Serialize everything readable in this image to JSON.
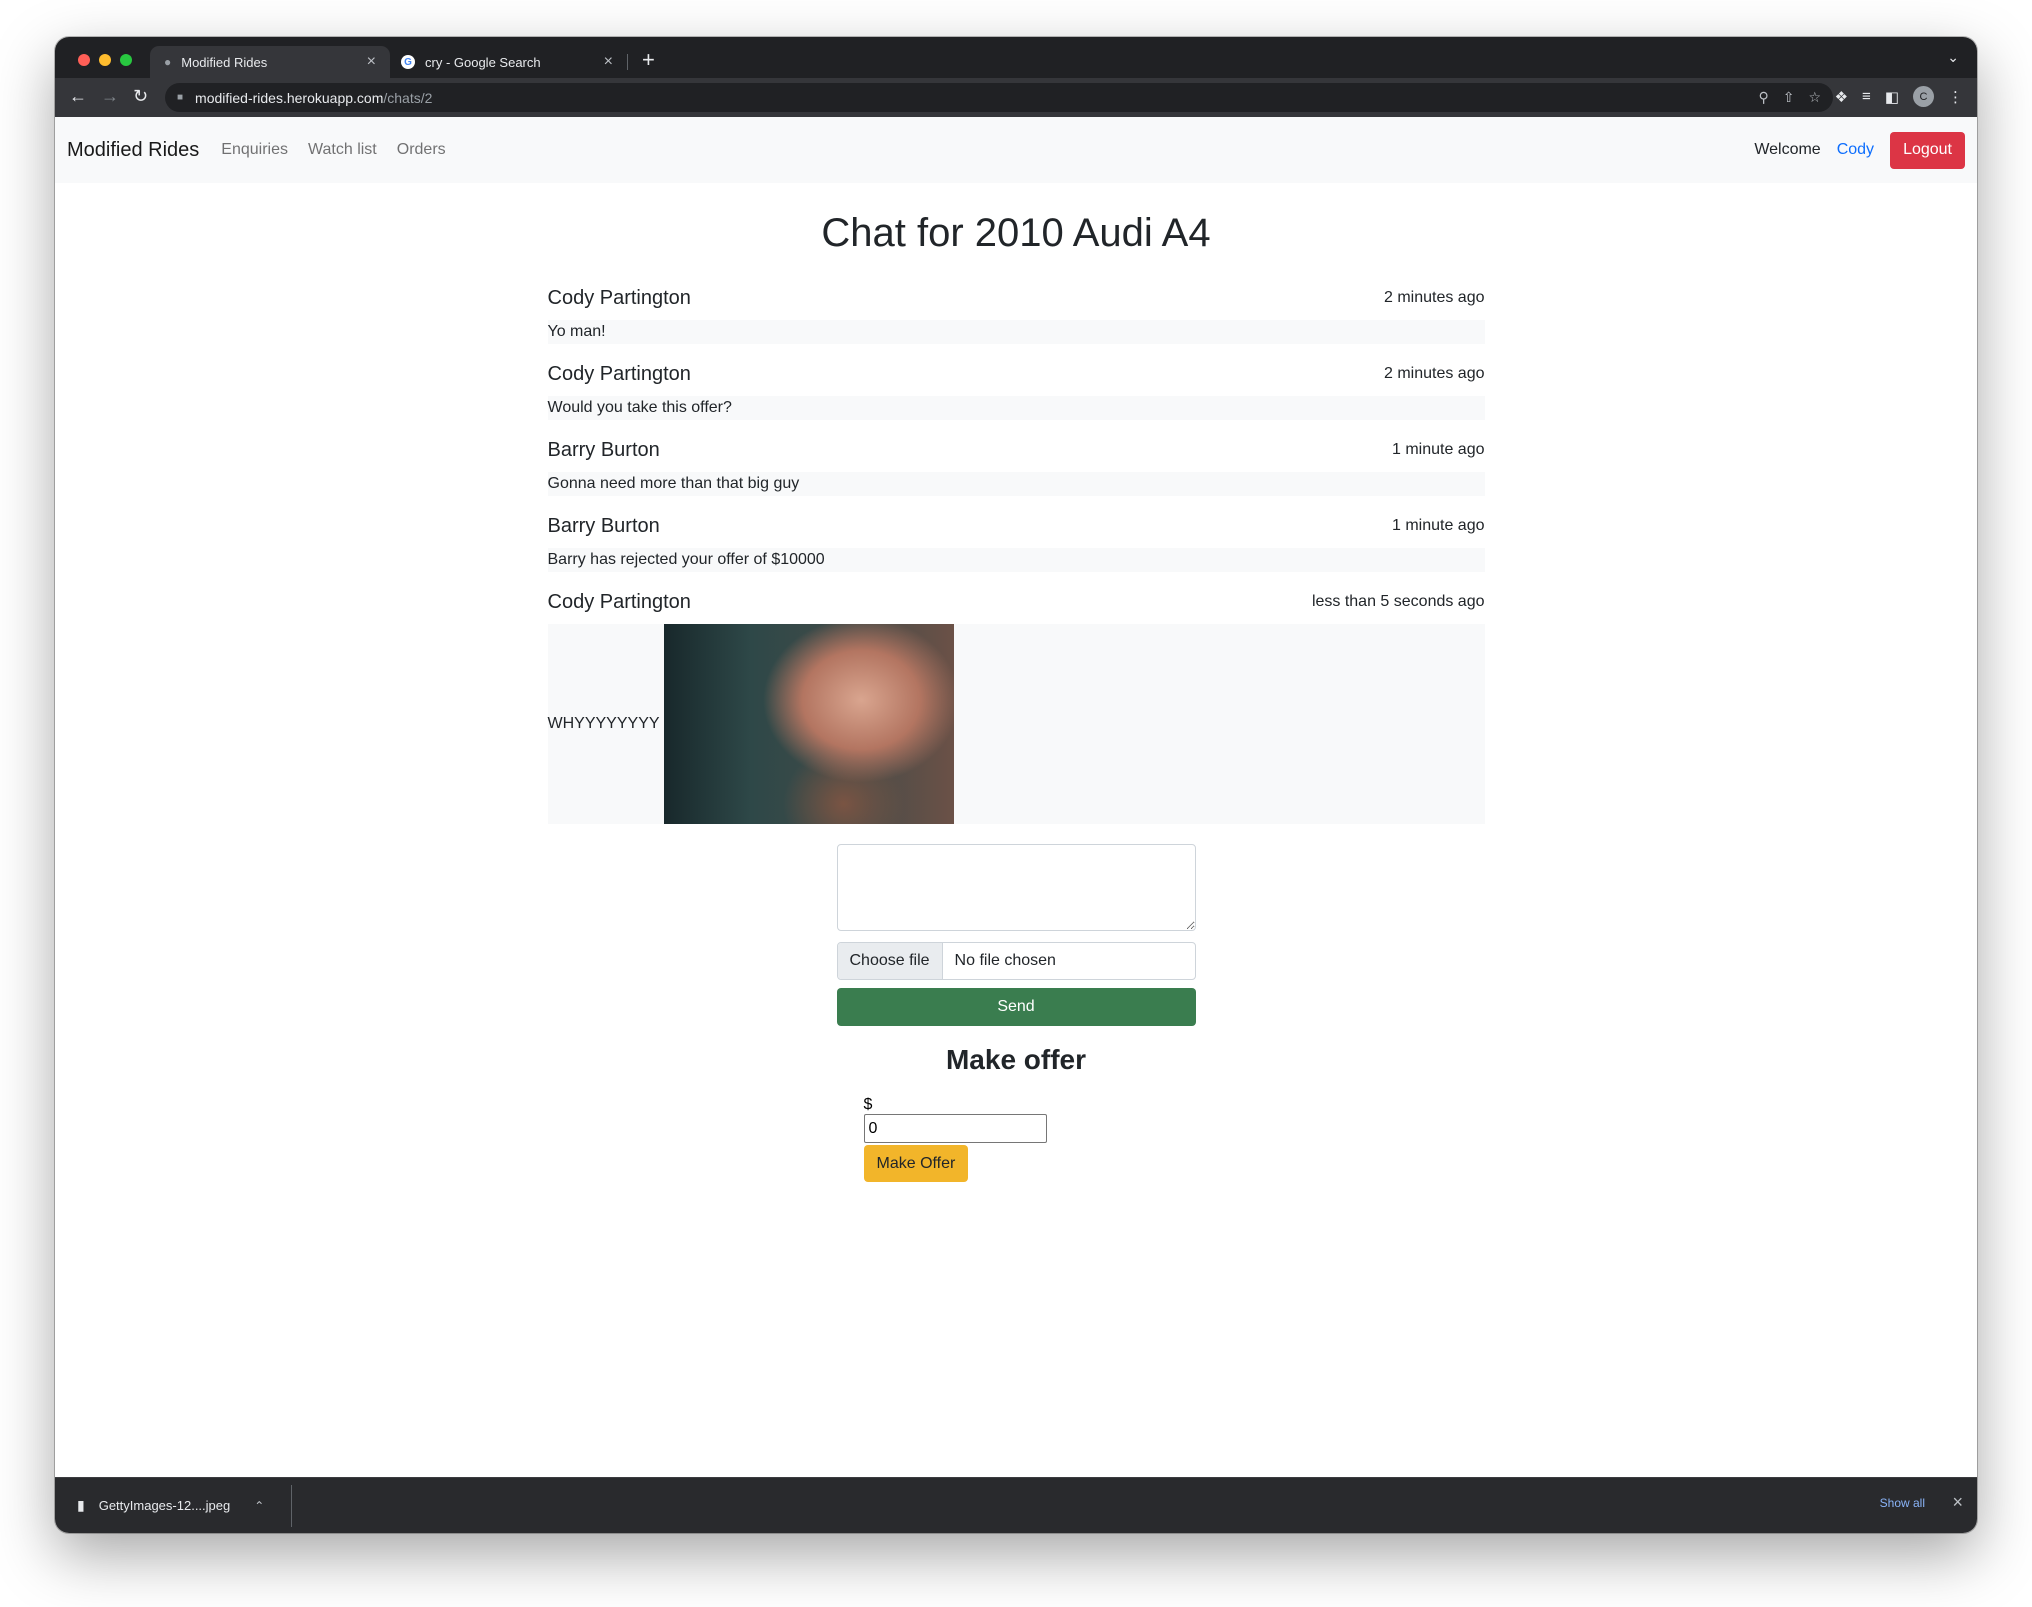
{
  "browser": {
    "tabs": [
      {
        "title": "Modified Rides",
        "active": true
      },
      {
        "title": "cry - Google Search",
        "active": false
      }
    ],
    "url_host": "modified-rides.herokuapp.com",
    "url_path": "/chats/2",
    "profile_initial": "C",
    "traffic_colors": [
      "#ff5f57",
      "#febc2e",
      "#28c840"
    ]
  },
  "navbar": {
    "brand": "Modified Rides",
    "links": [
      "Enquiries",
      "Watch list",
      "Orders"
    ],
    "welcome": "Welcome",
    "user": "Cody",
    "logout": "Logout"
  },
  "chat": {
    "title": "Chat for 2010 Audi A4",
    "messages": [
      {
        "author": "Cody Partington",
        "time": "2 minutes ago",
        "text": "Yo man!"
      },
      {
        "author": "Cody Partington",
        "time": "2 minutes ago",
        "text": "Would you take this offer?"
      },
      {
        "author": "Barry Burton",
        "time": "1 minute ago",
        "text": "Gonna need more than that big guy"
      },
      {
        "author": "Barry Burton",
        "time": "1 minute ago",
        "text": "Barry has rejected your offer of $10000"
      },
      {
        "author": "Cody Partington",
        "time": "less than 5 seconds ago",
        "text": "WHYYYYYYYY",
        "image": "crying-man-photo"
      }
    ]
  },
  "compose": {
    "choose_file": "Choose file",
    "file_status": "No file chosen",
    "send": "Send"
  },
  "offer": {
    "title": "Make offer",
    "currency": "$",
    "amount": "0",
    "button": "Make Offer"
  },
  "downloads": {
    "file": "GettyImages-12....jpeg",
    "show_all": "Show all"
  },
  "colors": {
    "logout": "#dc3545",
    "send": "#3a7d4f",
    "make_offer": "#f2b52a",
    "user_link": "#0d6efd"
  }
}
